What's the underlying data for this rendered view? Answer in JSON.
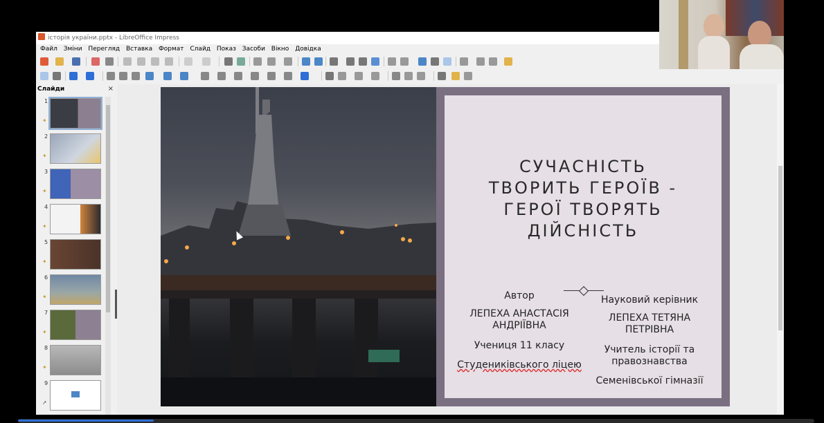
{
  "window": {
    "title": "історія україни.pptx - LibreOffice Impress"
  },
  "menu": [
    "Файл",
    "Зміни",
    "Перегляд",
    "Вставка",
    "Формат",
    "Слайд",
    "Показ",
    "Засоби",
    "Вікно",
    "Довідка"
  ],
  "sidebar": {
    "title": "Слайди",
    "close_icon": "close-icon",
    "slides": [
      {
        "num": "1",
        "selected": true
      },
      {
        "num": "2"
      },
      {
        "num": "3"
      },
      {
        "num": "4"
      },
      {
        "num": "5"
      },
      {
        "num": "6"
      },
      {
        "num": "7"
      },
      {
        "num": "8"
      },
      {
        "num": "9"
      }
    ]
  },
  "slide": {
    "title_lines": [
      "СУЧАСНІСТЬ",
      "ТВОРИТЬ ГЕРОЇВ -",
      "ГЕРОЇ ТВОРЯТЬ",
      "ДІЙСНІСТЬ"
    ],
    "left": {
      "label": "Автор",
      "name": "ЛЕПЕХА АНАСТАСІЯ АНДРІЇВНА",
      "grade": "Учениця 11 класу",
      "school": "Студениківського ліцею"
    },
    "right": {
      "label": "Науковий керівник",
      "name": "ЛЕПЕХА ТЕТЯНА ПЕТРІВНА",
      "role": "Учитель історії та правознавства",
      "school": "Семенівської гімназії"
    }
  },
  "colors": {
    "slide_panel_border": "#7b6f82",
    "slide_panel_bg": "#e6dfe6",
    "progress": "#2d6fd6"
  },
  "video_progress_fraction": 0.17
}
